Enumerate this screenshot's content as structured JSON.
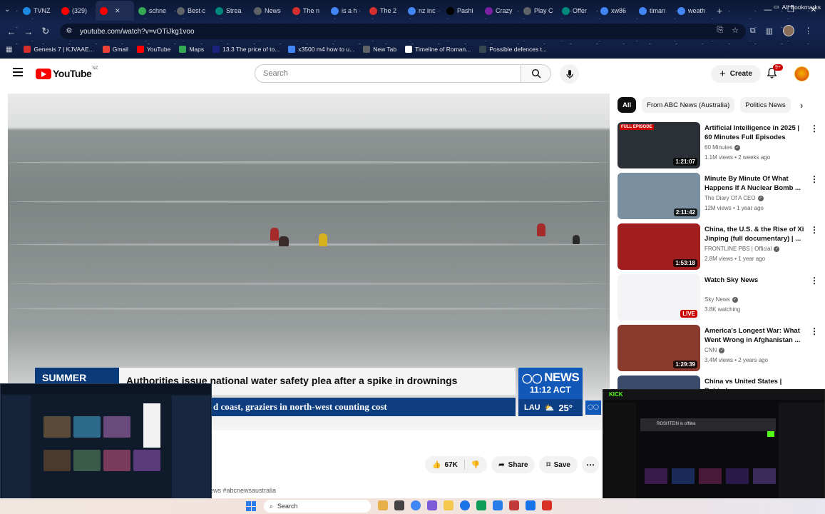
{
  "browser": {
    "tabs": [
      {
        "label": "TVNZ",
        "color": "#1e88e5"
      },
      {
        "label": "(329)",
        "color": "#ff0000"
      },
      {
        "label": "",
        "color": "#ff0000",
        "active": true
      },
      {
        "label": "schne",
        "color": "#34a853"
      },
      {
        "label": "Best c",
        "color": "#5f6368"
      },
      {
        "label": "Strea",
        "color": "#00897b"
      },
      {
        "label": "News",
        "color": "#5f6368"
      },
      {
        "label": "The n",
        "color": "#d32f2f"
      },
      {
        "label": "is a h",
        "color": "#4285f4"
      },
      {
        "label": "The 2",
        "color": "#d32f2f"
      },
      {
        "label": "nz inc",
        "color": "#4285f4"
      },
      {
        "label": "Pashi",
        "color": "#000000"
      },
      {
        "label": "Crazy",
        "color": "#7b1fa2"
      },
      {
        "label": "Play C",
        "color": "#5f6368"
      },
      {
        "label": "Offer",
        "color": "#00897b"
      },
      {
        "label": "xw86",
        "color": "#4285f4"
      },
      {
        "label": "timan",
        "color": "#4285f4"
      },
      {
        "label": "weath",
        "color": "#4285f4"
      }
    ],
    "url": "youtube.com/watch?v=vOTiJkg1voo",
    "bookmarks": [
      {
        "label": "Genesis 7 | KJVAAE...",
        "color": "#d32f2f"
      },
      {
        "label": "Gmail",
        "color": "#ea4335"
      },
      {
        "label": "YouTube",
        "color": "#ff0000"
      },
      {
        "label": "Maps",
        "color": "#34a853"
      },
      {
        "label": "13.3 The price of to...",
        "color": "#1a237e"
      },
      {
        "label": "x3500 m4 how to u...",
        "color": "#4285f4"
      },
      {
        "label": "New Tab",
        "color": "#5f6368"
      },
      {
        "label": "Timeline of Roman...",
        "color": "#ffffff"
      },
      {
        "label": "Possible defences t...",
        "color": "#37474f"
      }
    ],
    "all_bookmarks": "All Bookmarks"
  },
  "youtube": {
    "logo_text": "YouTube",
    "country": "NZ",
    "search_placeholder": "Search",
    "create_label": "Create",
    "notification_count": "9+"
  },
  "video": {
    "lower_third": {
      "tag": "SUMMER",
      "headline": "Authorities issue national water safety plea after a spike in drownings",
      "ticker": "d coast, graziers in north-west counting cost"
    },
    "abc": {
      "brand": "NEWS",
      "time": "11:12 ACT",
      "location": "LAU",
      "temperature": "25°"
    },
    "likes": "67K",
    "share_label": "Share",
    "save_label": "Save",
    "hashtags": "ews #abcnewsaustralia"
  },
  "sidebar": {
    "chips": [
      "All",
      "From ABC News (Australia)",
      "Politics News"
    ],
    "videos": [
      {
        "title": "Artificial Intelligence in 2025 | 60 Minutes Full Episodes",
        "channel": "60 Minutes",
        "meta": "1.1M views • 2 weeks ago",
        "duration": "1:21:07",
        "badge": "FULL EPISODE",
        "bg": "#2b2f36"
      },
      {
        "title": "Minute By Minute Of What Happens If A Nuclear Bomb ...",
        "channel": "The Diary Of A CEO",
        "meta": "12M views • 1 year ago",
        "duration": "2:11:42",
        "badge": "",
        "bg": "#7a8f9f"
      },
      {
        "title": "China, the U.S. & the Rise of Xi Jinping (full documentary) | ...",
        "channel": "FRONTLINE PBS | Official",
        "meta": "2.8M views • 1 year ago",
        "duration": "1:53:18",
        "badge": "",
        "bg": "#a11e1e"
      },
      {
        "title": "Watch Sky News",
        "channel": "Sky News",
        "meta": "3.8K watching",
        "duration": "LIVE",
        "badge": "",
        "bg": "#f4f4f6",
        "live": true
      },
      {
        "title": "America's Longest War: What Went Wrong in Afghanistan ...",
        "channel": "CNN",
        "meta": "3.4M views • 2 years ago",
        "duration": "1:29:39",
        "badge": "",
        "bg": "#8b3a2e"
      },
      {
        "title": "China vs United States | Behind",
        "channel": "",
        "meta": "",
        "duration": "",
        "badge": "",
        "bg": "#3a4a6a"
      }
    ]
  },
  "taskbar": {
    "search_label": "Search"
  },
  "overlays": {
    "right_banner": "ROSHTEIN is offline",
    "right_brand": "KICK"
  }
}
